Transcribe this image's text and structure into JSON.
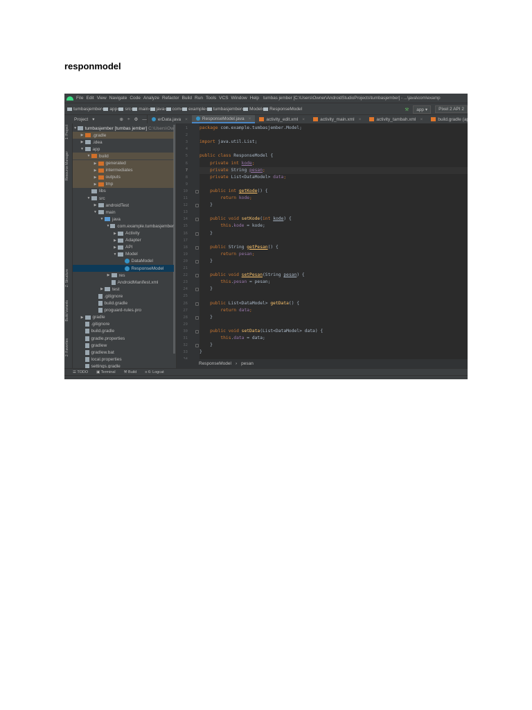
{
  "document": {
    "title": "responmodel"
  },
  "ide": {
    "menu": [
      "File",
      "Edit",
      "View",
      "Navigate",
      "Code",
      "Analyze",
      "Refactor",
      "Build",
      "Run",
      "Tools",
      "VCS",
      "Window",
      "Help"
    ],
    "window_title": "tumbas jember [C:\\Users\\Owner\\AndroidStudioProjects\\tumbasjember] - ...\\java\\com\\examp",
    "breadcrumbs": [
      "tumbasjember",
      "app",
      "src",
      "main",
      "java",
      "com",
      "example",
      "tumbasjember",
      "Model",
      "ResponseModel"
    ],
    "run_config": "app",
    "device": "Pixel 2 API 2",
    "project_view": "Project",
    "tabs": [
      {
        "label": "erData.java",
        "active": false
      },
      {
        "label": "ResponseModel.java",
        "active": true
      },
      {
        "label": "activity_edit.xml",
        "active": false
      },
      {
        "label": "activity_main.xml",
        "active": false
      },
      {
        "label": "activity_tambah.xml",
        "active": false
      },
      {
        "label": "build.gradle (ap",
        "active": false
      }
    ],
    "side_tools": [
      "1: Project",
      "Resource Manager",
      "Z: Structure",
      "Build Variants",
      "2: Favorites"
    ],
    "tree": [
      {
        "label": "tumbasjember [tumbas jember]",
        "extra": "C:\\Users\\Ow",
        "depth": 0,
        "arrow": "open",
        "icon": "folder",
        "state": ""
      },
      {
        "label": ".gradle",
        "depth": 1,
        "arrow": "closed",
        "icon": "orange",
        "state": "hl"
      },
      {
        "label": ".idea",
        "depth": 1,
        "arrow": "closed",
        "icon": "folder",
        "state": ""
      },
      {
        "label": "app",
        "depth": 1,
        "arrow": "open",
        "icon": "folder",
        "state": ""
      },
      {
        "label": "build",
        "depth": 2,
        "arrow": "open",
        "icon": "orange",
        "state": "hl"
      },
      {
        "label": "generated",
        "depth": 3,
        "arrow": "closed",
        "icon": "orange",
        "state": "hl"
      },
      {
        "label": "intermediates",
        "depth": 3,
        "arrow": "closed",
        "icon": "orange",
        "state": "hl"
      },
      {
        "label": "outputs",
        "depth": 3,
        "arrow": "closed",
        "icon": "orange",
        "state": "hl"
      },
      {
        "label": "tmp",
        "depth": 3,
        "arrow": "closed",
        "icon": "orange",
        "state": "hl"
      },
      {
        "label": "libs",
        "depth": 2,
        "arrow": "",
        "icon": "folder",
        "state": ""
      },
      {
        "label": "src",
        "depth": 2,
        "arrow": "open",
        "icon": "folder",
        "state": ""
      },
      {
        "label": "androidTest",
        "depth": 3,
        "arrow": "closed",
        "icon": "folder",
        "state": ""
      },
      {
        "label": "main",
        "depth": 3,
        "arrow": "open",
        "icon": "folder",
        "state": ""
      },
      {
        "label": "java",
        "depth": 4,
        "arrow": "open",
        "icon": "blue",
        "state": ""
      },
      {
        "label": "com.example.tumbasjember",
        "depth": 5,
        "arrow": "open",
        "icon": "folder",
        "state": ""
      },
      {
        "label": "Activity",
        "depth": 6,
        "arrow": "closed",
        "icon": "folder",
        "state": ""
      },
      {
        "label": "Adapter",
        "depth": 6,
        "arrow": "closed",
        "icon": "folder",
        "state": ""
      },
      {
        "label": "API",
        "depth": 6,
        "arrow": "closed",
        "icon": "folder",
        "state": ""
      },
      {
        "label": "Model",
        "depth": 6,
        "arrow": "open",
        "icon": "folder",
        "state": ""
      },
      {
        "label": "DataModel",
        "depth": 7,
        "arrow": "",
        "icon": "cls",
        "state": ""
      },
      {
        "label": "ResponseModel",
        "depth": 7,
        "arrow": "",
        "icon": "cls",
        "state": "sel"
      },
      {
        "label": "res",
        "depth": 5,
        "arrow": "closed",
        "icon": "folder",
        "state": ""
      },
      {
        "label": "AndroidManifest.xml",
        "depth": 5,
        "arrow": "",
        "icon": "file",
        "state": ""
      },
      {
        "label": "test",
        "depth": 4,
        "arrow": "closed",
        "icon": "folder",
        "state": ""
      },
      {
        "label": ".gitignore",
        "depth": 3,
        "arrow": "",
        "icon": "file",
        "state": ""
      },
      {
        "label": "build.gradle",
        "depth": 3,
        "arrow": "",
        "icon": "file",
        "state": ""
      },
      {
        "label": "proguard-rules.pro",
        "depth": 3,
        "arrow": "",
        "icon": "file",
        "state": ""
      },
      {
        "label": "gradle",
        "depth": 1,
        "arrow": "closed",
        "icon": "folder",
        "state": ""
      },
      {
        "label": ".gitignore",
        "depth": 1,
        "arrow": "",
        "icon": "file",
        "state": ""
      },
      {
        "label": "build.gradle",
        "depth": 1,
        "arrow": "",
        "icon": "file",
        "state": ""
      },
      {
        "label": "gradle.properties",
        "depth": 1,
        "arrow": "",
        "icon": "file",
        "state": ""
      },
      {
        "label": "gradlew",
        "depth": 1,
        "arrow": "",
        "icon": "file",
        "state": ""
      },
      {
        "label": "gradlew.bat",
        "depth": 1,
        "arrow": "",
        "icon": "file",
        "state": ""
      },
      {
        "label": "local.properties",
        "depth": 1,
        "arrow": "",
        "icon": "file",
        "state": ""
      },
      {
        "label": "settings.gradle",
        "depth": 1,
        "arrow": "",
        "icon": "file",
        "state": ""
      }
    ],
    "code": [
      [
        [
          "package ",
          "k"
        ],
        [
          "com.example.tumbasjember.Model;",
          "t"
        ]
      ],
      [],
      [
        [
          "import ",
          "k"
        ],
        [
          "java.util.List;",
          "t"
        ]
      ],
      [],
      [
        [
          "public class ",
          "k"
        ],
        [
          "ResponseModel {",
          "t"
        ]
      ],
      [
        [
          "    private int ",
          "k"
        ],
        [
          "kode",
          "f u"
        ],
        [
          ";",
          "k"
        ]
      ],
      [
        [
          "    private ",
          "k"
        ],
        [
          "String ",
          "t"
        ],
        [
          "pesan",
          "f u"
        ],
        [
          ";",
          "k"
        ]
      ],
      [
        [
          "    private ",
          "k"
        ],
        [
          "List<DataModel> ",
          "t"
        ],
        [
          "data",
          "f"
        ],
        [
          ";",
          "k"
        ]
      ],
      [],
      [
        [
          "    public int ",
          "k"
        ],
        [
          "getKode",
          "m u"
        ],
        [
          "() {",
          "t"
        ]
      ],
      [
        [
          "        return ",
          "k"
        ],
        [
          "kode",
          "f"
        ],
        [
          ";",
          "k"
        ]
      ],
      [
        [
          "    }",
          "t"
        ]
      ],
      [],
      [
        [
          "    public void ",
          "k"
        ],
        [
          "setKode",
          "m"
        ],
        [
          "(",
          "t"
        ],
        [
          "int ",
          "k"
        ],
        [
          "kode",
          "t u"
        ],
        [
          ") {",
          "t"
        ]
      ],
      [
        [
          "        this",
          "k"
        ],
        [
          ".",
          "t"
        ],
        [
          "kode",
          "f"
        ],
        [
          " = kode;",
          "t"
        ]
      ],
      [
        [
          "    }",
          "t"
        ]
      ],
      [],
      [
        [
          "    public ",
          "k"
        ],
        [
          "String ",
          "t"
        ],
        [
          "getPesan",
          "m u"
        ],
        [
          "() {",
          "t"
        ]
      ],
      [
        [
          "        return ",
          "k"
        ],
        [
          "pesan",
          "f"
        ],
        [
          ";",
          "k"
        ]
      ],
      [
        [
          "    }",
          "t"
        ]
      ],
      [],
      [
        [
          "    public void ",
          "k"
        ],
        [
          "setPesan",
          "m u"
        ],
        [
          "(String ",
          "t"
        ],
        [
          "pesan",
          "t u"
        ],
        [
          ") {",
          "t"
        ]
      ],
      [
        [
          "        this",
          "k"
        ],
        [
          ".",
          "t"
        ],
        [
          "pesan",
          "f"
        ],
        [
          " = pesan;",
          "t"
        ]
      ],
      [
        [
          "    }",
          "t"
        ]
      ],
      [],
      [
        [
          "    public ",
          "k"
        ],
        [
          "List<DataModel> ",
          "t"
        ],
        [
          "getData",
          "m"
        ],
        [
          "() {",
          "t"
        ]
      ],
      [
        [
          "        return ",
          "k"
        ],
        [
          "data",
          "f"
        ],
        [
          ";",
          "k"
        ]
      ],
      [
        [
          "    }",
          "t"
        ]
      ],
      [],
      [
        [
          "    public void ",
          "k"
        ],
        [
          "setData",
          "m"
        ],
        [
          "(List<DataModel> data) {",
          "t"
        ]
      ],
      [
        [
          "        this",
          "k"
        ],
        [
          ".",
          "t"
        ],
        [
          "data",
          "f"
        ],
        [
          " = data;",
          "t"
        ]
      ],
      [
        [
          "    }",
          "t"
        ]
      ],
      [
        [
          "}",
          "t"
        ]
      ],
      []
    ],
    "current_line": 7,
    "fold_lines": [
      10,
      12,
      14,
      16,
      18,
      20,
      22,
      24,
      26,
      28,
      30,
      32
    ],
    "editor_crumbs": [
      "ResponseModel",
      "pesan"
    ],
    "bottom_tools": [
      "TODO",
      "Terminal",
      "Build",
      "6: Logcat"
    ]
  }
}
